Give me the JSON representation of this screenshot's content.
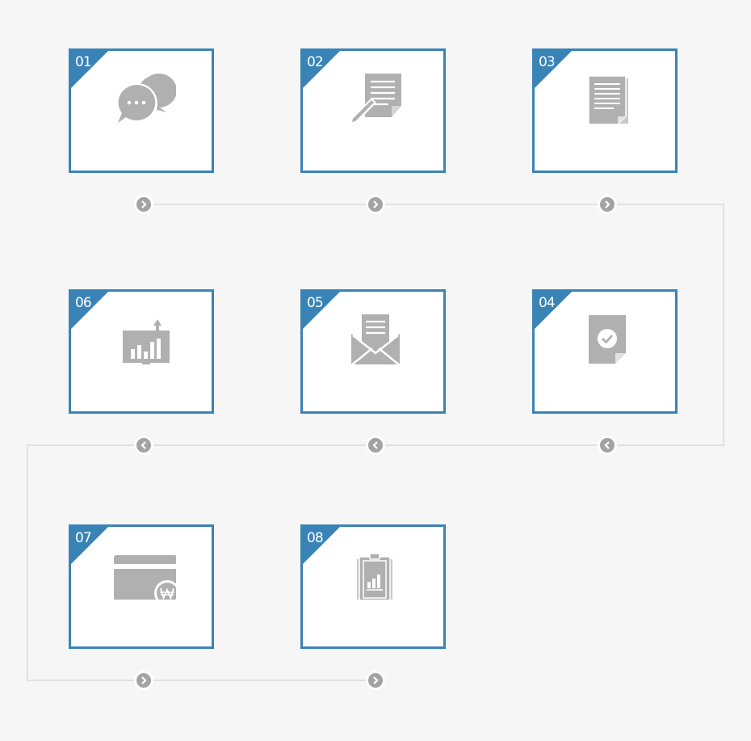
{
  "theme": {
    "background": "#f6f6f6",
    "accent": "#3a83b6",
    "icon_gray": "#b0b0b0",
    "connector": "#e1e1e1",
    "arrow_fill": "#a3a3a3"
  },
  "steps": [
    {
      "number": "01",
      "icon": "chat-bubbles-icon"
    },
    {
      "number": "02",
      "icon": "document-pen-icon"
    },
    {
      "number": "03",
      "icon": "document-stack-icon"
    },
    {
      "number": "04",
      "icon": "approved-document-icon"
    },
    {
      "number": "05",
      "icon": "envelope-letter-icon"
    },
    {
      "number": "06",
      "icon": "growth-chart-monitor-icon"
    },
    {
      "number": "07",
      "icon": "card-payment-won-icon"
    },
    {
      "number": "08",
      "icon": "clipboard-report-icon"
    }
  ],
  "flow": {
    "row1_direction": "right",
    "row2_direction": "left",
    "row3_direction": "right"
  }
}
